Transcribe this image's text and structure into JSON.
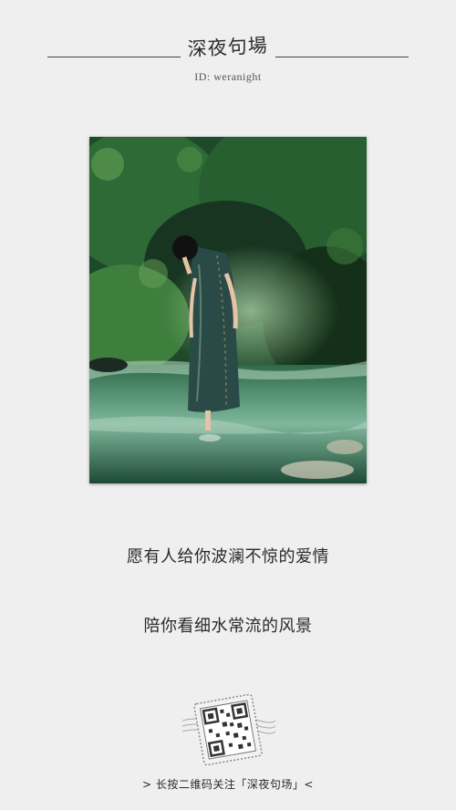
{
  "header": {
    "brand_logo_text": "深夜句場",
    "account_id": "ID: weranight"
  },
  "photo": {
    "description_icon": "photo-woman-in-stream"
  },
  "quote": {
    "line1": "愿有人给你波澜不惊的爱情",
    "line2": "陪你看细水常流的风景"
  },
  "footer": {
    "qr_icon": "qr-code-stamp-icon",
    "call_to_action": "> 长按二维码关注「深夜句场」<"
  },
  "colors": {
    "background": "#efefef",
    "text": "#222222",
    "rule": "#444444"
  }
}
